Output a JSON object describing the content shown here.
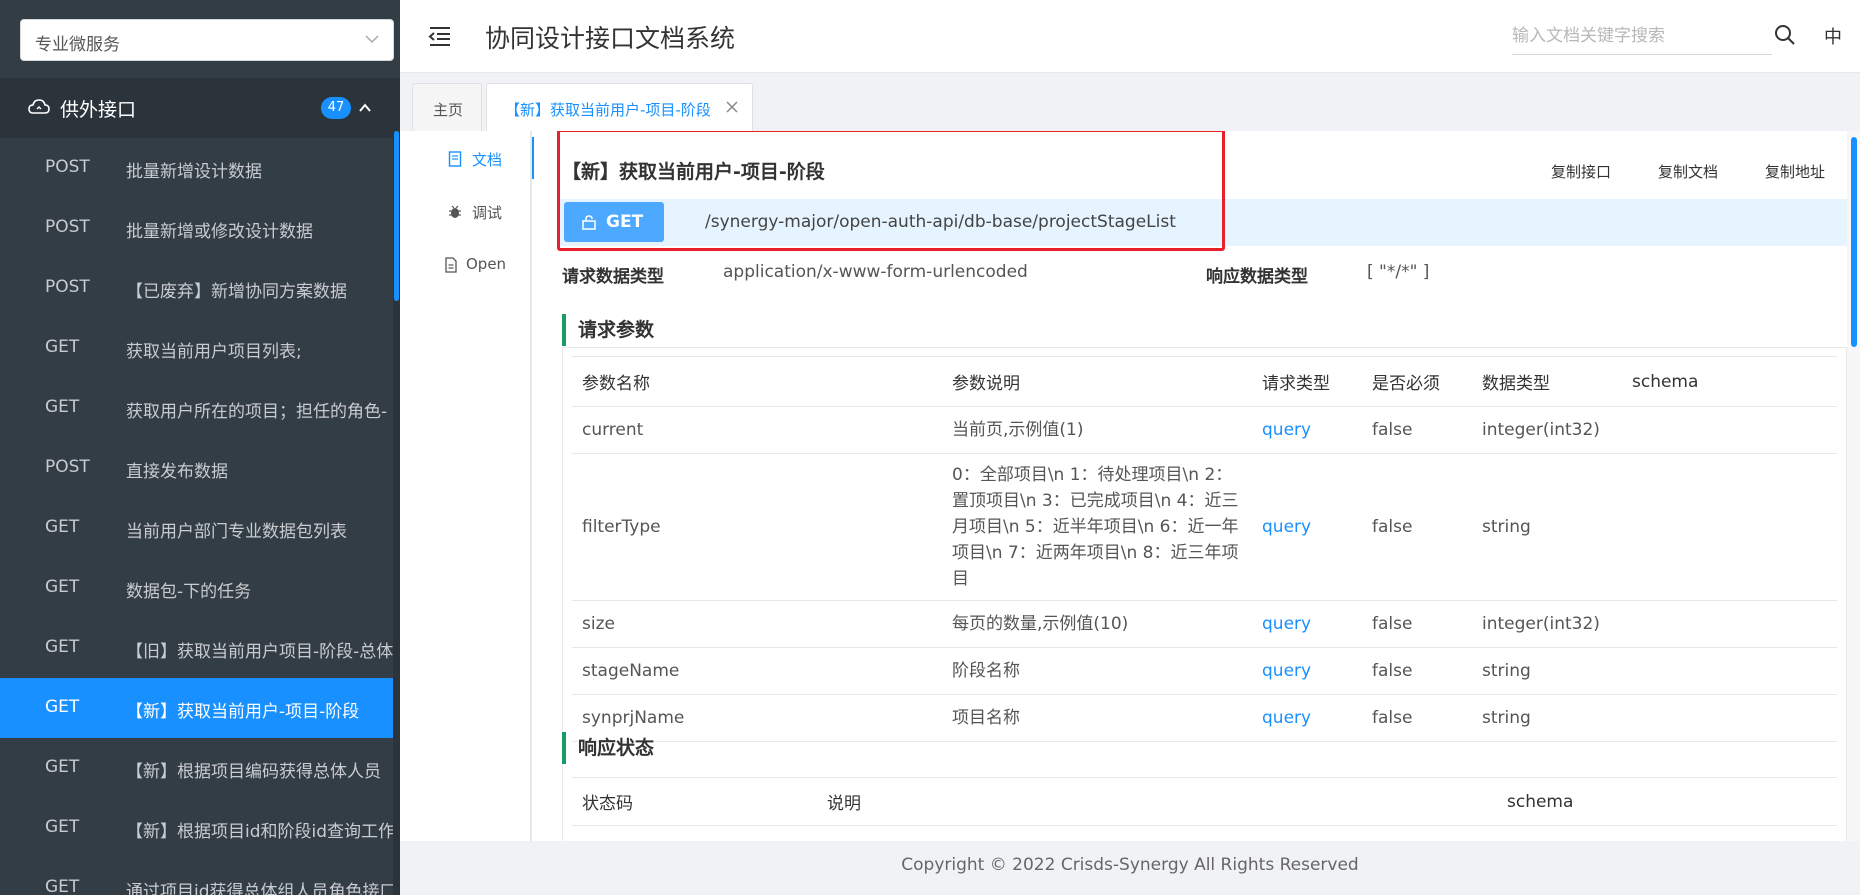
{
  "sidebar": {
    "service_select": "专业微服务",
    "group_label": "供外接口",
    "group_count": "47",
    "items": [
      {
        "method": "POST",
        "title": "批量新增设计数据",
        "active": false
      },
      {
        "method": "POST",
        "title": "批量新增或修改设计数据",
        "active": false
      },
      {
        "method": "POST",
        "title": "【已废弃】新增协同方案数据",
        "active": false
      },
      {
        "method": "GET",
        "title": "获取当前用户项目列表;",
        "active": false
      },
      {
        "method": "GET",
        "title": "获取用户所在的项目；担任的角色-",
        "active": false
      },
      {
        "method": "POST",
        "title": "直接发布数据",
        "active": false
      },
      {
        "method": "GET",
        "title": "当前用户部门专业数据包列表",
        "active": false
      },
      {
        "method": "GET",
        "title": "数据包-下的任务",
        "active": false
      },
      {
        "method": "GET",
        "title": "【旧】获取当前用户项目-阶段-总体",
        "active": false
      },
      {
        "method": "GET",
        "title": "【新】获取当前用户-项目-阶段",
        "active": true
      },
      {
        "method": "GET",
        "title": "【新】根据项目编码获得总体人员",
        "active": false
      },
      {
        "method": "GET",
        "title": "【新】根据项目id和阶段id查询工作",
        "active": false
      },
      {
        "method": "GET",
        "title": "通过项目id获得总体组人员角色接口",
        "active": false
      }
    ]
  },
  "header": {
    "app_title": "协同设计接口文档系统",
    "search_placeholder": "输入文档关键字搜索",
    "lang": "中"
  },
  "tabs": {
    "home": "主页",
    "current": "【新】获取当前用户-项目-阶段"
  },
  "vtabs": {
    "doc": "文档",
    "debug": "调试",
    "open": "Open"
  },
  "doc": {
    "title": "【新】获取当前用户-项目-阶段",
    "copy_api": "复制接口",
    "copy_doc": "复制文档",
    "copy_url": "复制地址",
    "method": "GET",
    "path": "/synergy-major/open-auth-api/db-base/projectStageList",
    "req_type_label": "请求数据类型",
    "req_type": "application/x-www-form-urlencoded",
    "resp_type_label": "响应数据类型",
    "resp_type": "[ \"*/*\" ]",
    "params_title": "请求参数",
    "params_headers": [
      "参数名称",
      "参数说明",
      "请求类型",
      "是否必须",
      "数据类型",
      "schema"
    ],
    "params": [
      {
        "name": "current",
        "desc": "当前页,示例值(1)",
        "in": "query",
        "required": "false",
        "type": "integer(int32)",
        "schema": ""
      },
      {
        "name": "filterType",
        "desc": "0：全部项目\\n 1：待处理项目\\n 2：置顶项目\\n 3：已完成项目\\n 4：近三月项目\\n 5：近半年项目\\n 6：近一年项目\\n 7：近两年项目\\n 8：近三年项目",
        "in": "query",
        "required": "false",
        "type": "string",
        "schema": ""
      },
      {
        "name": "size",
        "desc": "每页的数量,示例值(10)",
        "in": "query",
        "required": "false",
        "type": "integer(int32)",
        "schema": ""
      },
      {
        "name": "stageName",
        "desc": "阶段名称",
        "in": "query",
        "required": "false",
        "type": "string",
        "schema": ""
      },
      {
        "name": "synprjName",
        "desc": "项目名称",
        "in": "query",
        "required": "false",
        "type": "string",
        "schema": ""
      }
    ],
    "resp_title": "响应状态",
    "resp_headers": [
      "状态码",
      "说明",
      "schema"
    ]
  },
  "footer": {
    "copyright": "Copyright © 2022 Crisds-Synergy All Rights Reserved"
  },
  "colors": {
    "sidebar_bg": "#333d45",
    "accent": "#1890ff",
    "highlight": "#e8202a",
    "section_bar": "#1a9c66"
  }
}
